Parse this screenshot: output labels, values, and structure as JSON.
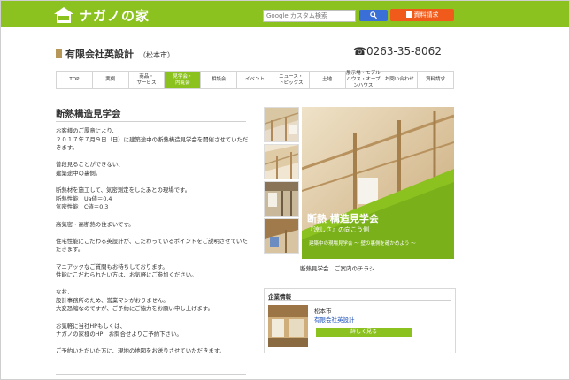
{
  "header": {
    "logo_text": "ナガノの家",
    "search_placeholder": "Google カスタム検索",
    "request_label": "資料請求"
  },
  "company": {
    "name": "有限会社英設計",
    "location": "（松本市）",
    "phone": "☎0263-35-8062"
  },
  "nav": [
    {
      "label": "TOP"
    },
    {
      "label": "実例"
    },
    {
      "label": "商品・\nサービス"
    },
    {
      "label": "見学会・\n内覧会",
      "active": true
    },
    {
      "label": "相談会"
    },
    {
      "label": "イベント"
    },
    {
      "label": "ニュース・\nトピックス"
    },
    {
      "label": "土地"
    },
    {
      "label": "展示場・モデル\nハウス・オープ\nンハウス"
    },
    {
      "label": "お問い合わせ"
    },
    {
      "label": "資料請求"
    }
  ],
  "article": {
    "title": "断熱構造見学会",
    "paragraphs": [
      "お客様のご厚意により、\n２０１７年７月９日（日）に建築途中の断熱構造見学会を開催させていただきます。",
      "普段見ることができない、\n建築途中の裏側。",
      "断熱材を施工して、気密測定をしたあとの現場です。\n断熱性能　Ua値＝0.4\n気密性能　C値＝0.3",
      "高気密・高断熱の住まいです。",
      "住宅性能にこだわる英設計が、こだわっているポイントをご説明させていただきます。",
      "マニアックなご質問もお待ちしております。\n性能にこだわられたい方は、お気軽にご参加ください。",
      "なお、\n設計事務所のため、営業マンがおりません。\n大変恐縮なのですが、ご予約にご協力をお願い申し上げます。",
      "お気軽に当社HPもしくは、\nナガノの家様のHP　お問合せよりご予約下さい。",
      "ご予約いただいた方に、現地の地図をお送りさせていただきます。"
    ]
  },
  "gallery": {
    "main_title": "断熱 構造見学会",
    "main_subtitle": "『涼しさ』の向こう側",
    "main_tagline": "建築中の現場見学会 ～ 壁の裏側を確かめよう ～",
    "caption": "断熱見学会　ご案内のチラシ"
  },
  "company_card": {
    "heading": "企業情報",
    "location": "松本市",
    "link": "有限会社英設計",
    "button": "詳しく見る"
  },
  "colors": {
    "brand_green": "#8cc21f",
    "request_orange": "#f05a1a",
    "search_blue": "#3a6fd8",
    "link_blue": "#1a4fb8"
  }
}
